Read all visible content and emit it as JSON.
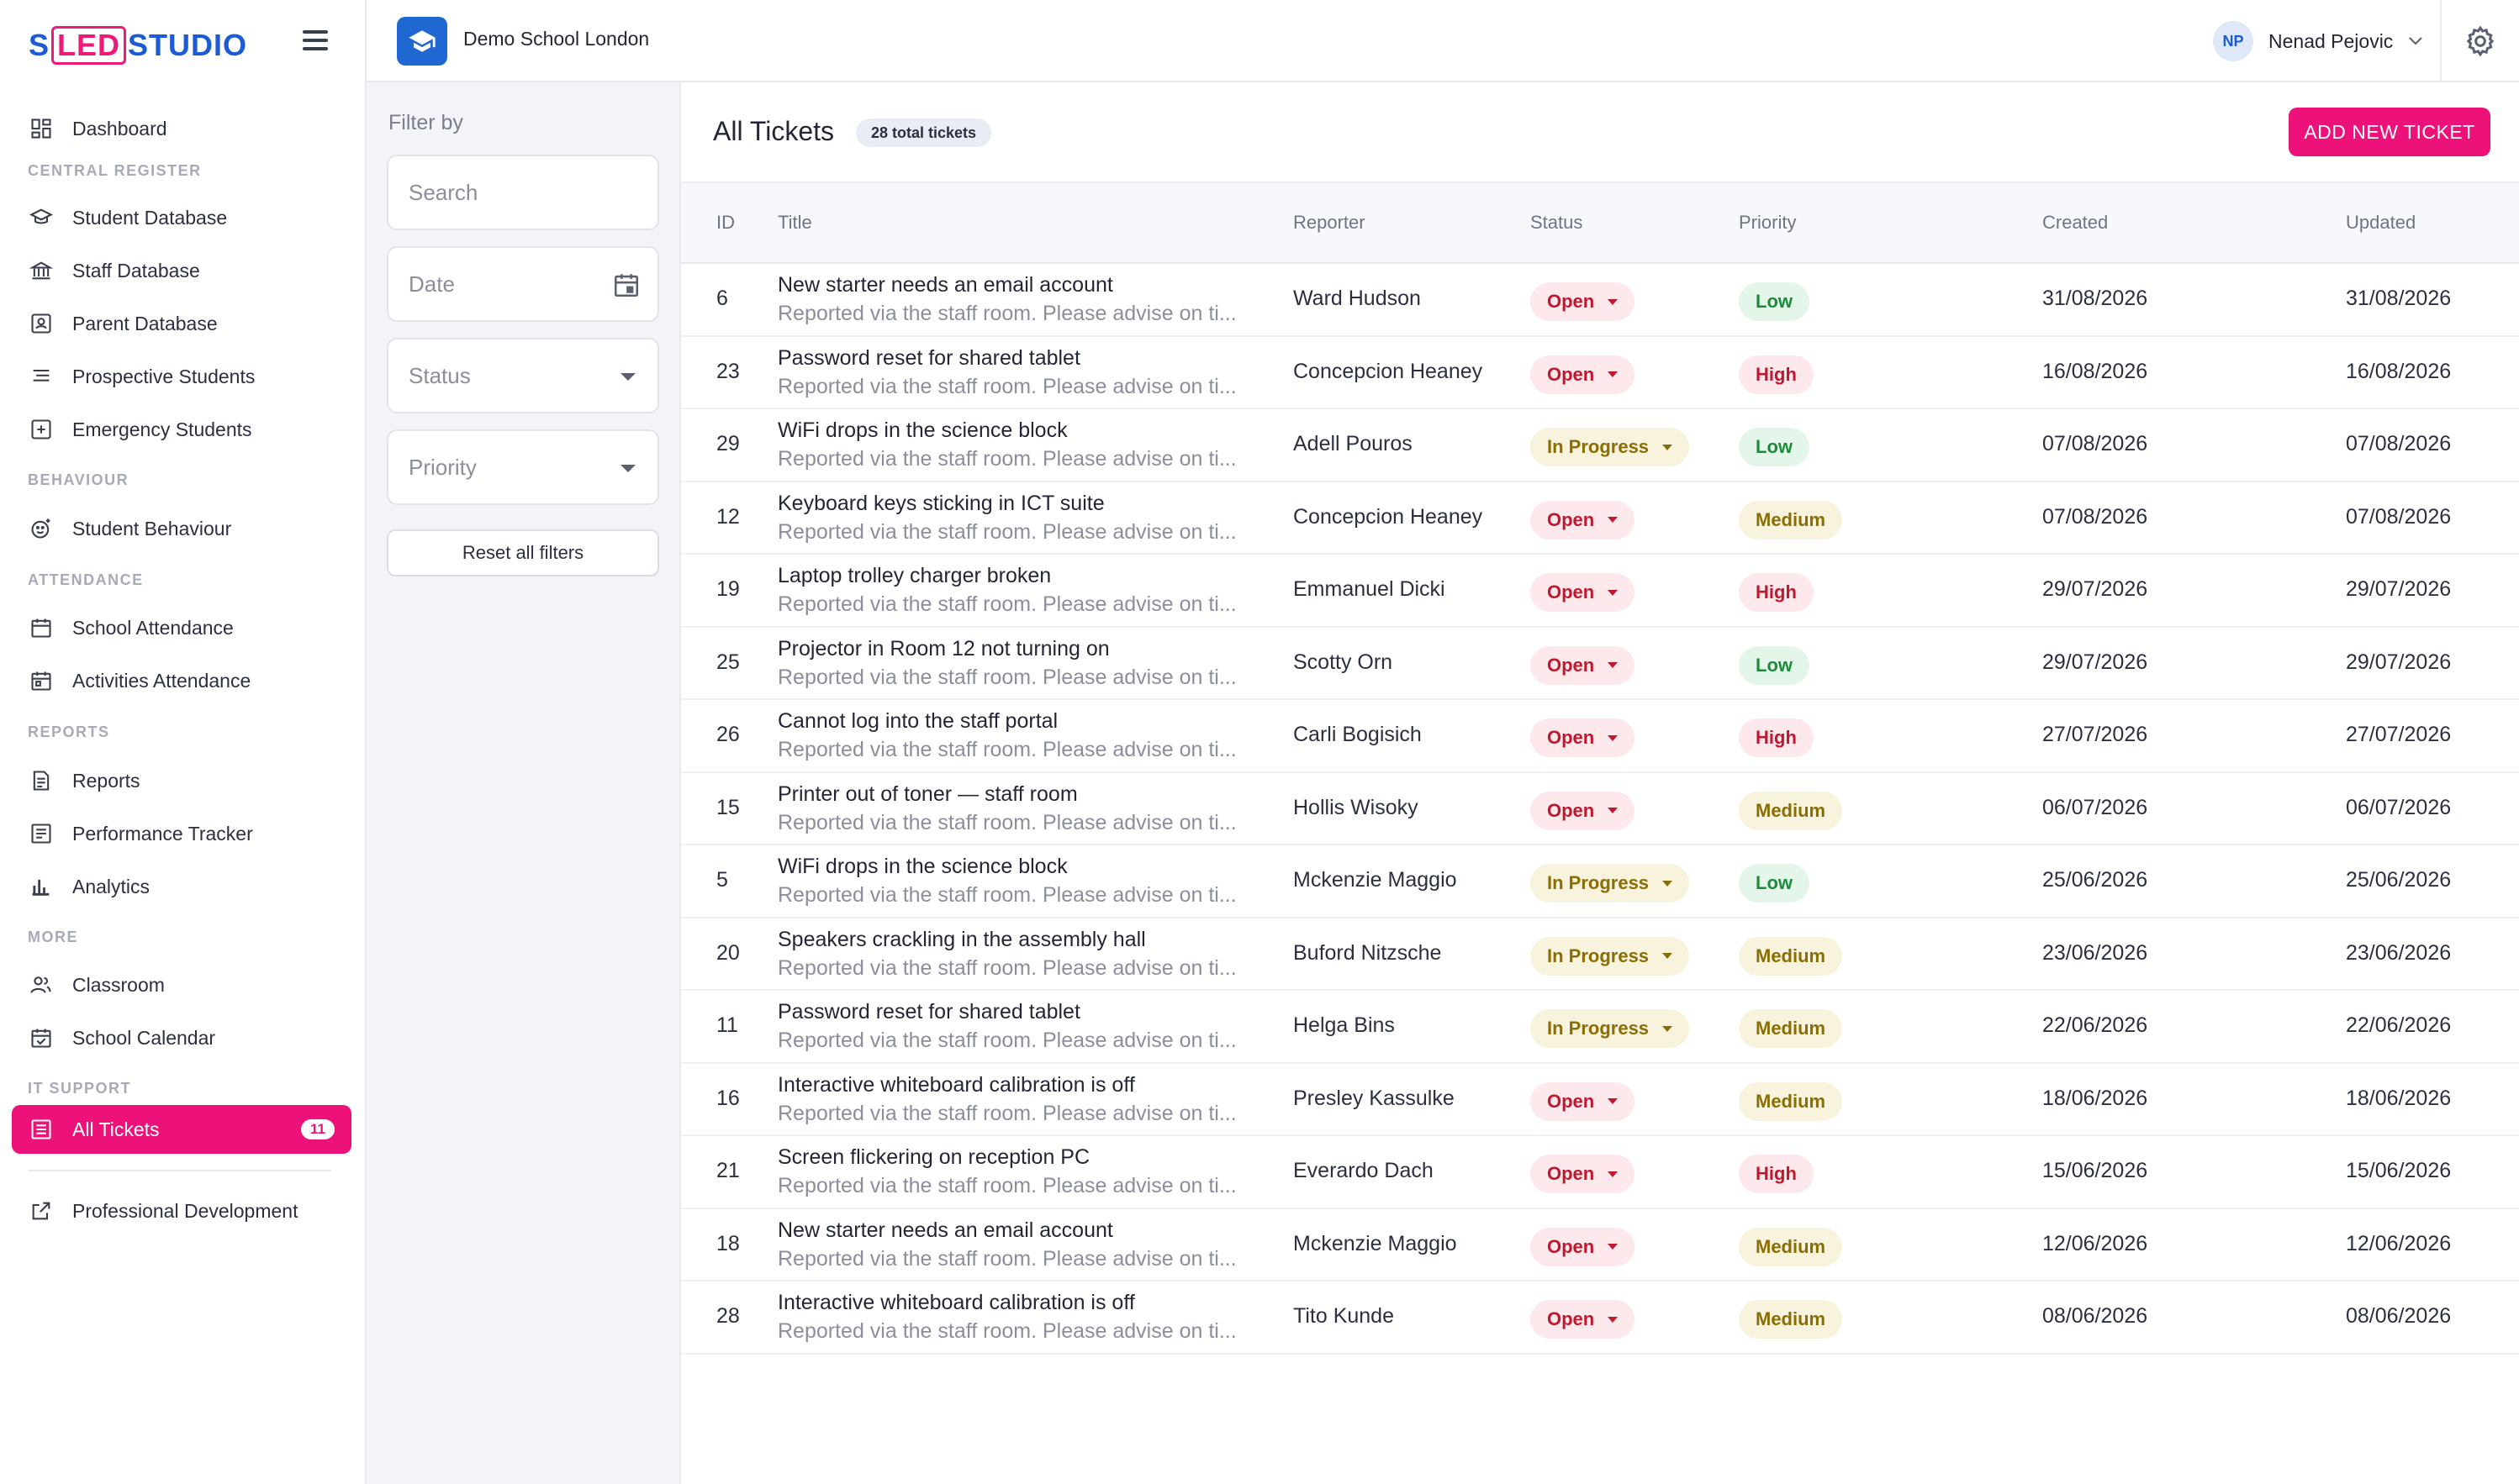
{
  "brand": {
    "name_pre": "S",
    "name_mid": "LED",
    "name_post": "STUDIO"
  },
  "header": {
    "school_name": "Demo School London",
    "user_initials": "NP",
    "user_name": "Nenad Pejovic"
  },
  "sidebar": {
    "items": [
      {
        "label": "Dashboard",
        "icon": "dashboard-icon"
      },
      {
        "label": "Student Database",
        "icon": "graduation-cap-icon"
      },
      {
        "label": "Staff Database",
        "icon": "bank-icon"
      },
      {
        "label": "Parent Database",
        "icon": "contact-card-icon"
      },
      {
        "label": "Prospective Students",
        "icon": "list-icon"
      },
      {
        "label": "Emergency Students",
        "icon": "plus-box-icon"
      },
      {
        "label": "Student Behaviour",
        "icon": "smiley-icon"
      },
      {
        "label": "School Attendance",
        "icon": "calendar-icon"
      },
      {
        "label": "Activities Attendance",
        "icon": "calendar-check-icon"
      },
      {
        "label": "Reports",
        "icon": "document-icon"
      },
      {
        "label": "Performance Tracker",
        "icon": "tracker-icon"
      },
      {
        "label": "Analytics",
        "icon": "bar-chart-icon"
      },
      {
        "label": "Classroom",
        "icon": "people-icon"
      },
      {
        "label": "School Calendar",
        "icon": "calendar-check-icon"
      },
      {
        "label": "All Tickets",
        "icon": "ticket-list-icon",
        "badge": "11"
      },
      {
        "label": "Professional Development",
        "icon": "external-link-icon"
      }
    ],
    "sections": {
      "central_register": "CENTRAL REGISTER",
      "behaviour": "BEHAVIOUR",
      "attendance": "ATTENDANCE",
      "reports": "REPORTS",
      "more": "MORE",
      "it_support": "IT SUPPORT"
    }
  },
  "filters": {
    "title": "Filter by",
    "search_placeholder": "Search",
    "date_placeholder": "Date",
    "status_label": "Status",
    "priority_label": "Priority",
    "reset_label": "Reset all filters"
  },
  "main": {
    "title": "All Tickets",
    "count_label": "28 total tickets",
    "add_button": "ADD NEW TICKET",
    "columns": [
      "ID",
      "Title",
      "Reporter",
      "Status",
      "Priority",
      "Created",
      "Updated"
    ],
    "rows": [
      {
        "id": "6",
        "title": "New starter needs an email account",
        "desc": "Reported via the staff room. Please advise on ti...",
        "reporter": "Ward Hudson",
        "status": "Open",
        "priority": "Low",
        "created": "31/08/2026",
        "updated": "31/08/2026"
      },
      {
        "id": "23",
        "title": "Password reset for shared tablet",
        "desc": "Reported via the staff room. Please advise on ti...",
        "reporter": "Concepcion Heaney",
        "status": "Open",
        "priority": "High",
        "created": "16/08/2026",
        "updated": "16/08/2026"
      },
      {
        "id": "29",
        "title": "WiFi drops in the science block",
        "desc": "Reported via the staff room. Please advise on ti...",
        "reporter": "Adell Pouros",
        "status": "In Progress",
        "priority": "Low",
        "created": "07/08/2026",
        "updated": "07/08/2026"
      },
      {
        "id": "12",
        "title": "Keyboard keys sticking in ICT suite",
        "desc": "Reported via the staff room. Please advise on ti...",
        "reporter": "Concepcion Heaney",
        "status": "Open",
        "priority": "Medium",
        "created": "07/08/2026",
        "updated": "07/08/2026"
      },
      {
        "id": "19",
        "title": "Laptop trolley charger broken",
        "desc": "Reported via the staff room. Please advise on ti...",
        "reporter": "Emmanuel Dicki",
        "status": "Open",
        "priority": "High",
        "created": "29/07/2026",
        "updated": "29/07/2026"
      },
      {
        "id": "25",
        "title": "Projector in Room 12 not turning on",
        "desc": "Reported via the staff room. Please advise on ti...",
        "reporter": "Scotty Orn",
        "status": "Open",
        "priority": "Low",
        "created": "29/07/2026",
        "updated": "29/07/2026"
      },
      {
        "id": "26",
        "title": "Cannot log into the staff portal",
        "desc": "Reported via the staff room. Please advise on ti...",
        "reporter": "Carli Bogisich",
        "status": "Open",
        "priority": "High",
        "created": "27/07/2026",
        "updated": "27/07/2026"
      },
      {
        "id": "15",
        "title": "Printer out of toner — staff room",
        "desc": "Reported via the staff room. Please advise on ti...",
        "reporter": "Hollis Wisoky",
        "status": "Open",
        "priority": "Medium",
        "created": "06/07/2026",
        "updated": "06/07/2026"
      },
      {
        "id": "5",
        "title": "WiFi drops in the science block",
        "desc": "Reported via the staff room. Please advise on ti...",
        "reporter": "Mckenzie Maggio",
        "status": "In Progress",
        "priority": "Low",
        "created": "25/06/2026",
        "updated": "25/06/2026"
      },
      {
        "id": "20",
        "title": "Speakers crackling in the assembly hall",
        "desc": "Reported via the staff room. Please advise on ti...",
        "reporter": "Buford Nitzsche",
        "status": "In Progress",
        "priority": "Medium",
        "created": "23/06/2026",
        "updated": "23/06/2026"
      },
      {
        "id": "11",
        "title": "Password reset for shared tablet",
        "desc": "Reported via the staff room. Please advise on ti...",
        "reporter": "Helga Bins",
        "status": "In Progress",
        "priority": "Medium",
        "created": "22/06/2026",
        "updated": "22/06/2026"
      },
      {
        "id": "16",
        "title": "Interactive whiteboard calibration is off",
        "desc": "Reported via the staff room. Please advise on ti...",
        "reporter": "Presley Kassulke",
        "status": "Open",
        "priority": "Medium",
        "created": "18/06/2026",
        "updated": "18/06/2026"
      },
      {
        "id": "21",
        "title": "Screen flickering on reception PC",
        "desc": "Reported via the staff room. Please advise on ti...",
        "reporter": "Everardo Dach",
        "status": "Open",
        "priority": "High",
        "created": "15/06/2026",
        "updated": "15/06/2026"
      },
      {
        "id": "18",
        "title": "New starter needs an email account",
        "desc": "Reported via the staff room. Please advise on ti...",
        "reporter": "Mckenzie Maggio",
        "status": "Open",
        "priority": "Medium",
        "created": "12/06/2026",
        "updated": "12/06/2026"
      },
      {
        "id": "28",
        "title": "Interactive whiteboard calibration is off",
        "desc": "Reported via the staff room. Please advise on ti...",
        "reporter": "Tito Kunde",
        "status": "Open",
        "priority": "Medium",
        "created": "08/06/2026",
        "updated": "08/06/2026"
      }
    ]
  },
  "colors": {
    "accent": "#ec127a",
    "brand_blue": "#1c5bd6",
    "status_open": "#c0182f",
    "status_in_progress": "#8a6d05",
    "priority_low": "#1e8a3c"
  }
}
